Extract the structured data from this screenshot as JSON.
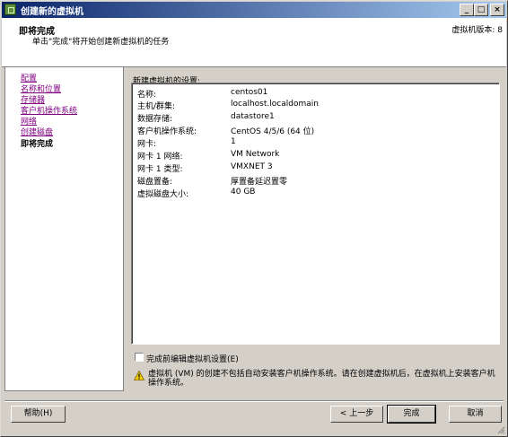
{
  "window": {
    "title": "创建新的虚拟机",
    "controls": {
      "minimize": "_",
      "maximize": "□",
      "close": "×"
    }
  },
  "header": {
    "title": "即将完成",
    "subtitle": "单击\"完成\"将开始创建新虚拟机的任务",
    "version": "虚拟机版本: 8"
  },
  "nav": {
    "items": [
      {
        "label": "配置",
        "current": false
      },
      {
        "label": "名称和位置",
        "current": false
      },
      {
        "label": "存储器",
        "current": false
      },
      {
        "label": "客户机操作系统",
        "current": false
      },
      {
        "label": "网络",
        "current": false
      },
      {
        "label": "创建磁盘",
        "current": false
      },
      {
        "label": "即将完成",
        "current": true
      }
    ]
  },
  "settings": {
    "label": "新建虚拟机的设置:",
    "rows": [
      {
        "key": "名称:",
        "value": "centos01"
      },
      {
        "key": "主机/群集:",
        "value": "localhost.localdomain"
      },
      {
        "key": "数据存储:",
        "value": "datastore1"
      },
      {
        "key": "客户机操作系统:",
        "value": "CentOS 4/5/6 (64 位)"
      },
      {
        "key": "网卡:",
        "value": "1"
      },
      {
        "key": "网卡 1 网络:",
        "value": "VM Network"
      },
      {
        "key": "网卡 1 类型:",
        "value": "VMXNET 3"
      },
      {
        "key": "磁盘置备:",
        "value": "厚置备延迟置零"
      },
      {
        "key": "虚拟磁盘大小:",
        "value": "40 GB"
      }
    ]
  },
  "edit_checkbox": {
    "label": "完成前编辑虚拟机设置(E)",
    "checked": false
  },
  "warning": {
    "text": "虚拟机 (VM) 的创建不包括自动安装客户机操作系统。请在创建虚拟机后，在虚拟机上安装客户机操作系统。",
    "icon": "warning-triangle-icon"
  },
  "buttons": {
    "help": "帮助(H)",
    "back": "< 上一步",
    "finish": "完成",
    "cancel": "取消"
  },
  "colors": {
    "title_bar_start": "#0a246a",
    "title_bar_end": "#a6caf0",
    "visited_link": "#800080",
    "warning_yellow": "#f5d000"
  }
}
